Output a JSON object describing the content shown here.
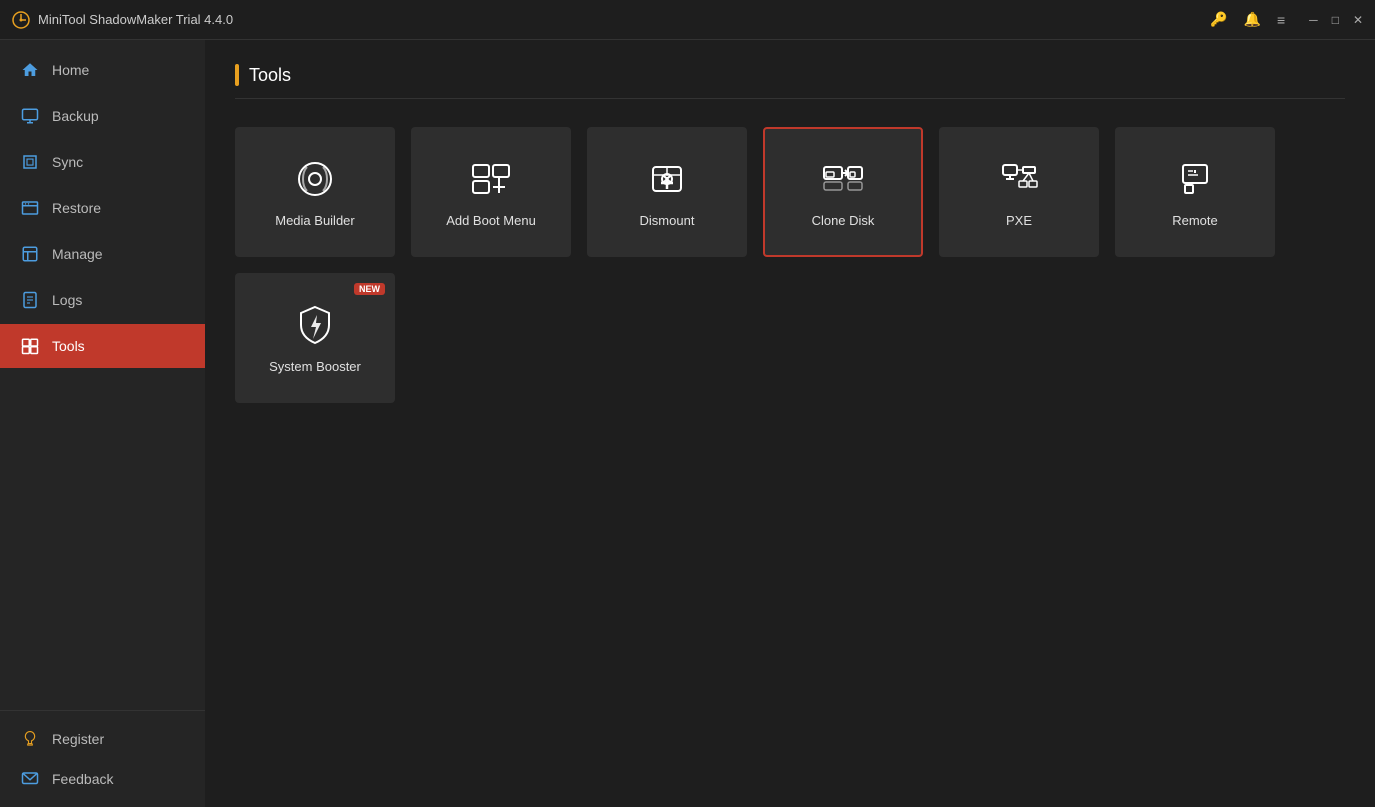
{
  "titleBar": {
    "title": "MiniTool ShadowMaker Trial 4.4.0",
    "icons": [
      "key",
      "bell",
      "menu",
      "minimize",
      "maximize",
      "close"
    ]
  },
  "sidebar": {
    "items": [
      {
        "label": "Home",
        "icon": "home",
        "active": false
      },
      {
        "label": "Backup",
        "icon": "backup",
        "active": false
      },
      {
        "label": "Sync",
        "icon": "sync",
        "active": false
      },
      {
        "label": "Restore",
        "icon": "restore",
        "active": false
      },
      {
        "label": "Manage",
        "icon": "manage",
        "active": false
      },
      {
        "label": "Logs",
        "icon": "logs",
        "active": false
      },
      {
        "label": "Tools",
        "icon": "tools",
        "active": true
      }
    ],
    "bottom": [
      {
        "label": "Register",
        "icon": "register"
      },
      {
        "label": "Feedback",
        "icon": "feedback"
      }
    ]
  },
  "page": {
    "title": "Tools"
  },
  "tools": [
    {
      "id": "media-builder",
      "label": "Media Builder",
      "icon": "media",
      "selected": false,
      "new": false
    },
    {
      "id": "add-boot-menu",
      "label": "Add Boot Menu",
      "icon": "boot",
      "selected": false,
      "new": false
    },
    {
      "id": "dismount",
      "label": "Dismount",
      "icon": "dismount",
      "selected": false,
      "new": false
    },
    {
      "id": "clone-disk",
      "label": "Clone Disk",
      "icon": "clone",
      "selected": true,
      "new": false
    },
    {
      "id": "pxe",
      "label": "PXE",
      "icon": "pxe",
      "selected": false,
      "new": false
    },
    {
      "id": "remote",
      "label": "Remote",
      "icon": "remote",
      "selected": false,
      "new": false
    },
    {
      "id": "system-booster",
      "label": "System Booster",
      "icon": "booster",
      "selected": false,
      "new": true
    }
  ]
}
